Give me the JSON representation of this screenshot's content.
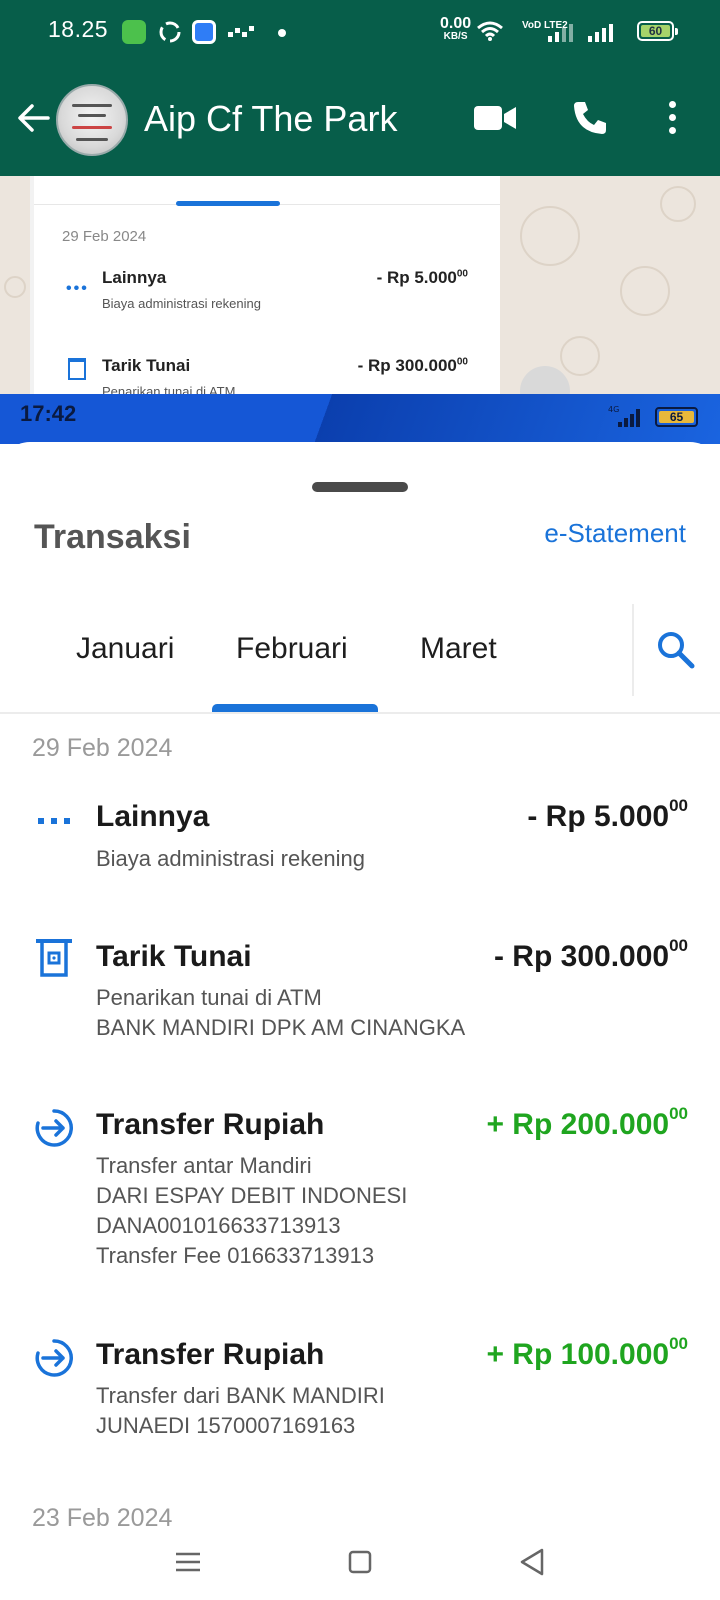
{
  "whatsapp": {
    "status": {
      "time": "18.25",
      "net_speed": "0.00",
      "net_unit": "KB/S",
      "volte": "VoD LTE2",
      "battery": "60"
    },
    "header": {
      "contact_name": "Aip Cf The Park"
    },
    "preview": {
      "date": "29 Feb 2024",
      "rows": [
        {
          "title": "Lainnya",
          "subtitle": "Biaya administrasi rekening",
          "amount": "- Rp 5.000",
          "cents": "00"
        },
        {
          "title": "Tarik Tunai",
          "subtitle": "Penarikan tunai di ATM",
          "amount": "- Rp 300.000",
          "cents": "00"
        }
      ]
    }
  },
  "bank": {
    "status": {
      "time": "17:42",
      "network": "4G",
      "battery": "65"
    },
    "sheet": {
      "title": "Transaksi",
      "estatement_label": "e-Statement",
      "tabs": [
        "Januari",
        "Februari",
        "Maret"
      ],
      "active_tab": "Februari"
    },
    "groups": [
      {
        "date": "29 Feb 2024",
        "transactions": [
          {
            "icon": "more-dots-icon",
            "title": "Lainnya",
            "amount": "- Rp 5.000",
            "cents": "00",
            "direction": "debit",
            "description": "Biaya administrasi rekening"
          },
          {
            "icon": "atm-icon",
            "title": "Tarik Tunai",
            "amount": "- Rp 300.000",
            "cents": "00",
            "direction": "debit",
            "description": "Penarikan tunai di ATM\nBANK MANDIRI DPK AM CINANGKA"
          },
          {
            "icon": "transfer-in-icon",
            "title": "Transfer Rupiah",
            "amount": "+ Rp 200.000",
            "cents": "00",
            "direction": "credit",
            "description": "Transfer antar Mandiri\nDARI ESPAY DEBIT INDONESI\nDANA001016633713913\nTransfer Fee 016633713913"
          },
          {
            "icon": "transfer-in-icon",
            "title": "Transfer Rupiah",
            "amount": "+ Rp 100.000",
            "cents": "00",
            "direction": "credit",
            "description": "Transfer dari BANK MANDIRI\nJUNAEDI 1570007169163"
          }
        ]
      },
      {
        "date": "23 Feb 2024",
        "transactions": []
      }
    ],
    "colors": {
      "accent": "#1a73d9",
      "credit": "#1fa51f",
      "whatsapp_green": "#075e4a"
    }
  }
}
